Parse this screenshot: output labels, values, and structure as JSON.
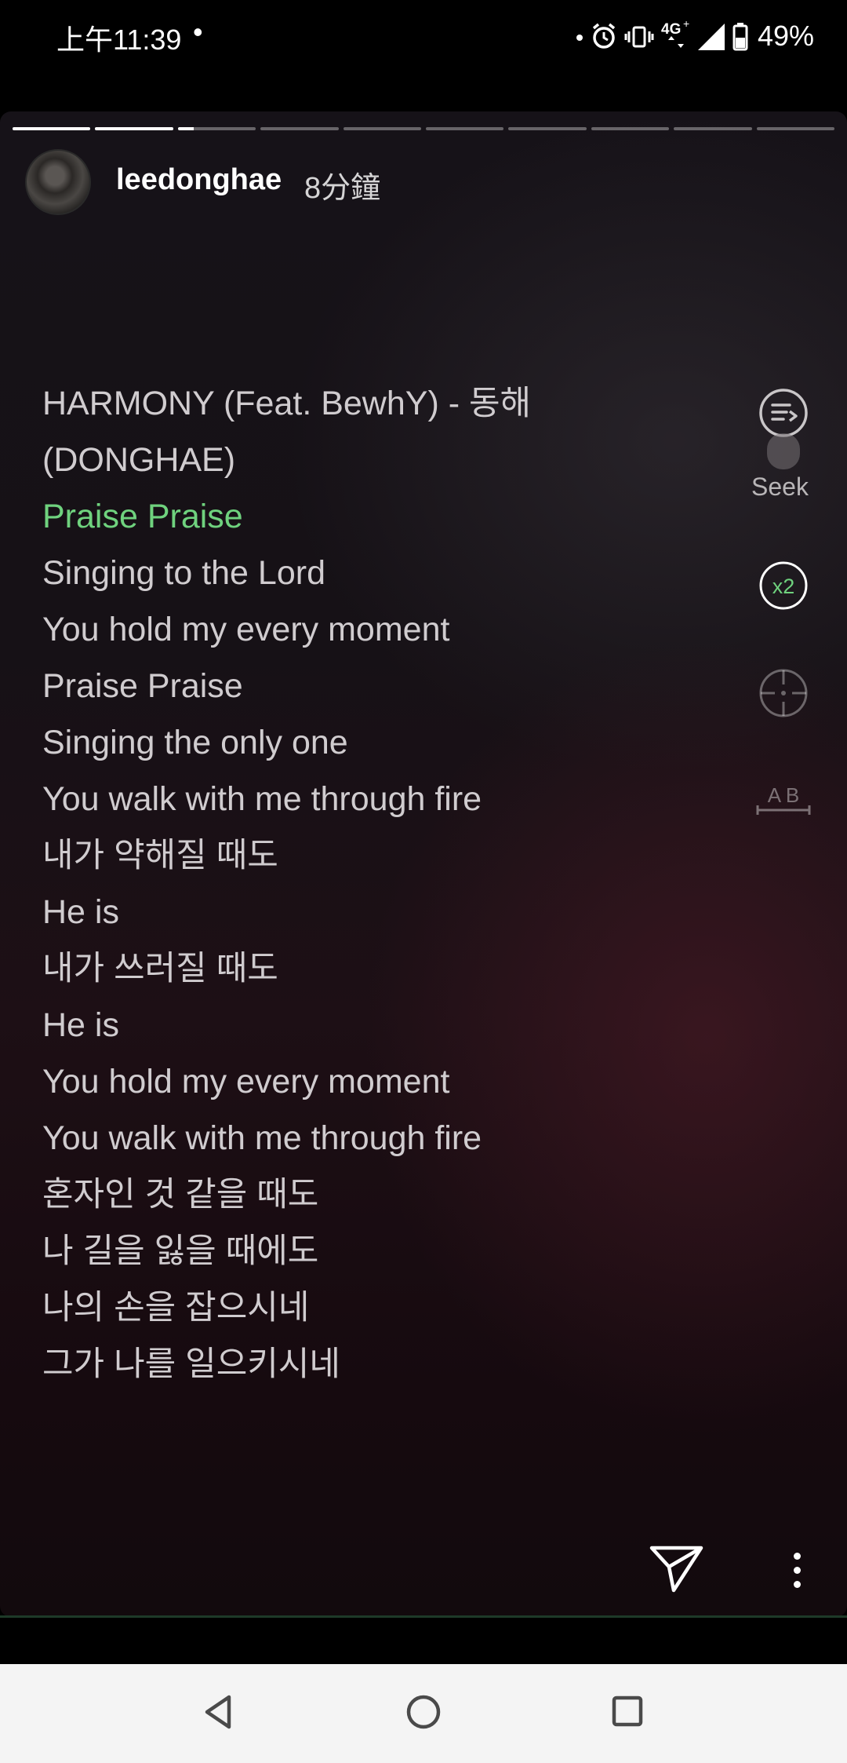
{
  "status_bar": {
    "time": "上午11:39",
    "dot": "•",
    "network": "4G",
    "battery": "49%"
  },
  "story": {
    "username": "leedonghae",
    "time_ago": "8分鐘",
    "segments": [
      1,
      1,
      0.2,
      0,
      0,
      0,
      0,
      0,
      0,
      0
    ]
  },
  "lyrics": [
    "HARMONY (Feat. BewhY) - 동해",
    "(DONGHAE)",
    "Praise Praise",
    "Singing to the Lord",
    "You hold my every moment",
    "Praise Praise",
    "Singing the only one",
    "You walk with me through fire",
    "내가 약해질 때도",
    "He is",
    "내가 쓰러질 때도",
    "He is",
    "You hold my every moment",
    "You walk with me through fire",
    "혼자인 것 같을 때도",
    "나 길을 잃을 때에도",
    "나의 손을 잡으시네",
    "그가 나를 일으키시네"
  ],
  "active_lyric_index": 2,
  "controls": {
    "seek_label": "Seek",
    "speed_label": "x2",
    "ab_label": "A B"
  },
  "colors": {
    "active_lyric": "#6fd27e"
  },
  "icons": {
    "send": "send-icon",
    "more": "more-vertical-icon",
    "back": "back-triangle-icon",
    "home": "home-circle-icon",
    "recents": "recents-square-icon"
  }
}
